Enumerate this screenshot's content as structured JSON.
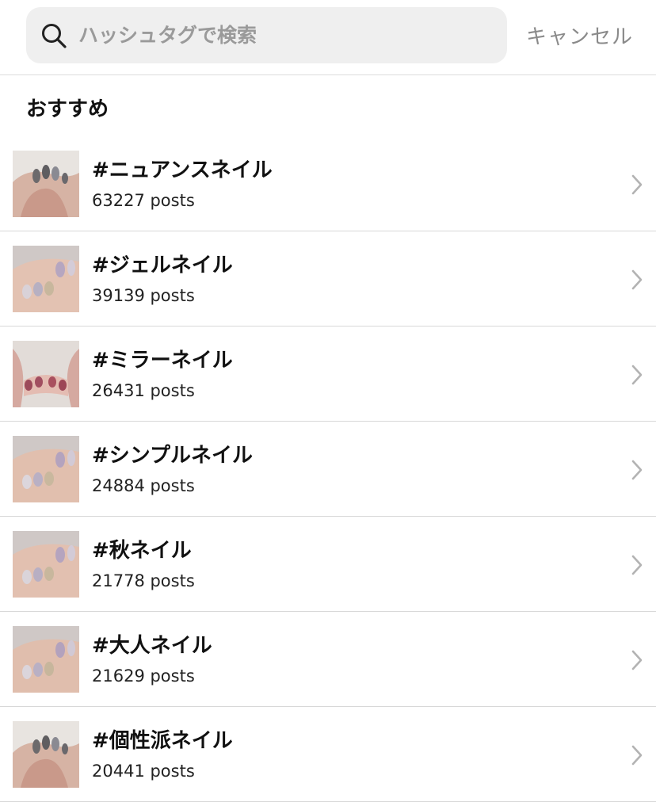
{
  "search": {
    "placeholder": "ハッシュタグで検索",
    "value": "",
    "cancel_label": "キャンセル"
  },
  "section": {
    "title": "おすすめ"
  },
  "tags": [
    {
      "name": "#ニュアンスネイル",
      "count": "63227 posts",
      "thumb_icon": "nail-photo"
    },
    {
      "name": "#ジェルネイル",
      "count": "39139 posts",
      "thumb_icon": "nail-photo"
    },
    {
      "name": "#ミラーネイル",
      "count": "26431 posts",
      "thumb_icon": "nail-photo"
    },
    {
      "name": "#シンプルネイル",
      "count": "24884 posts",
      "thumb_icon": "nail-photo"
    },
    {
      "name": "#秋ネイル",
      "count": "21778 posts",
      "thumb_icon": "nail-photo"
    },
    {
      "name": "#大人ネイル",
      "count": "21629 posts",
      "thumb_icon": "nail-photo"
    },
    {
      "name": "#個性派ネイル",
      "count": "20441 posts",
      "thumb_icon": "nail-photo"
    }
  ],
  "colors": {
    "search_bg": "#efefef",
    "divider": "#d8d8d8",
    "muted_text": "#8a8a8a",
    "chevron": "#b3b3b3"
  }
}
